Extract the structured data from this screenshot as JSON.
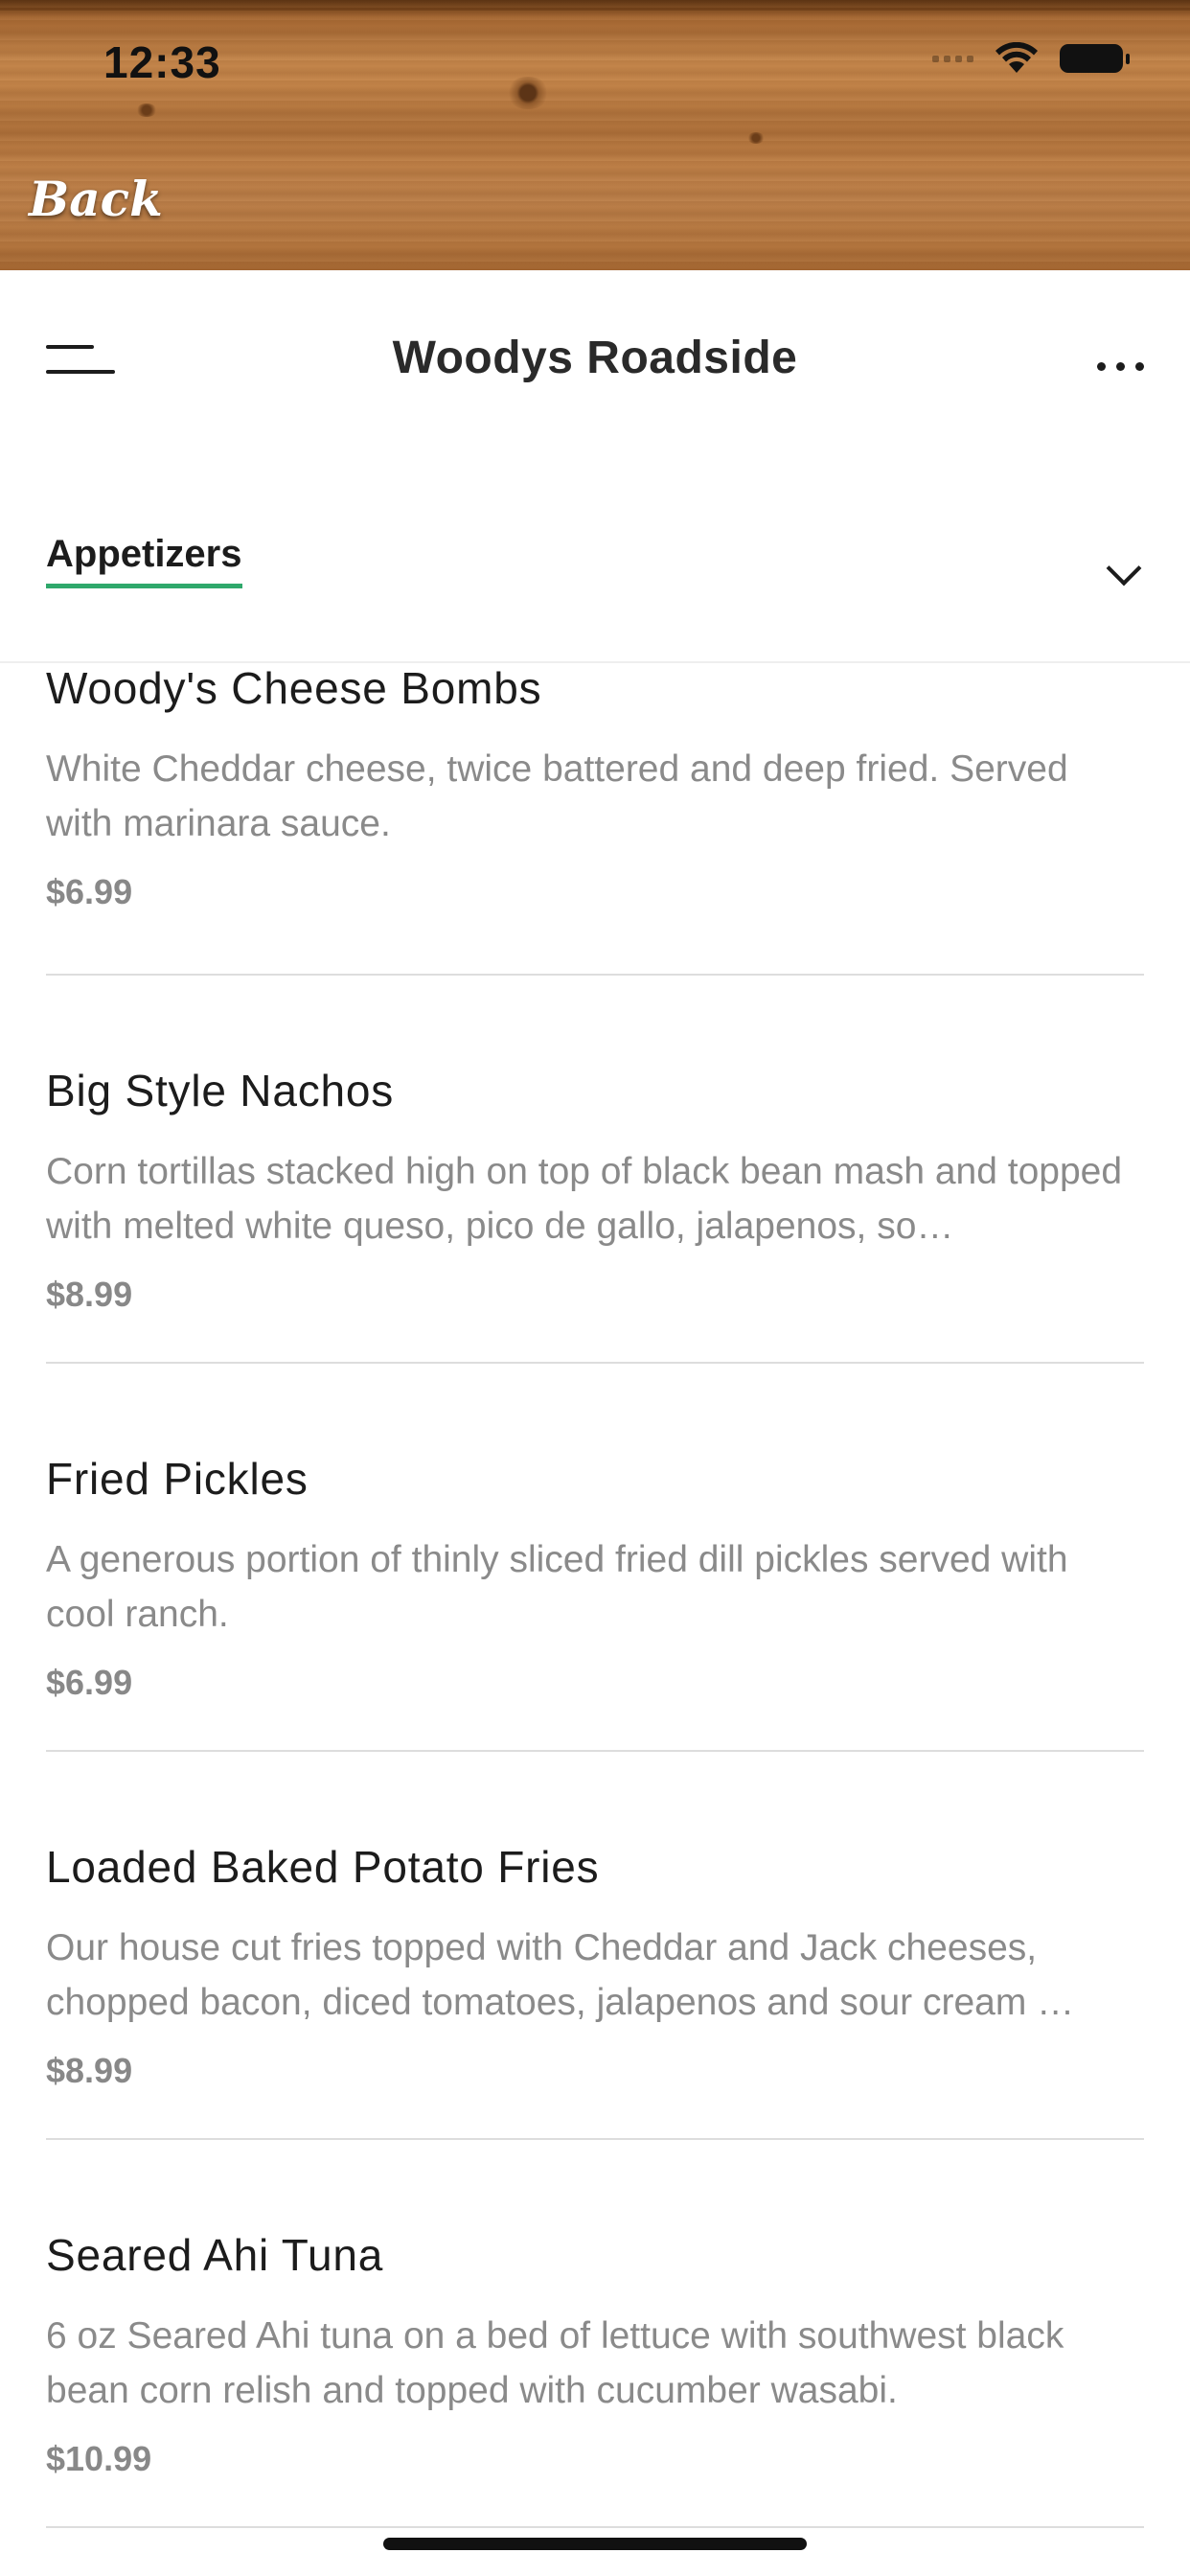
{
  "status_bar": {
    "time": "12:33"
  },
  "header": {
    "back_label": "Back"
  },
  "navbar": {
    "title": "Woodys Roadside"
  },
  "category": {
    "selected": "Appetizers"
  },
  "menu_items": [
    {
      "name": "Woody's Cheese Bombs",
      "description": "White Cheddar cheese, twice battered and deep fried. Served with marinara sauce.",
      "price": "$6.99"
    },
    {
      "name": "Big Style Nachos",
      "description": "Corn tortillas stacked high on top of black bean mash and topped with melted white queso, pico de gallo, jalapenos, so…",
      "price": "$8.99"
    },
    {
      "name": "Fried Pickles",
      "description": "A generous portion of thinly sliced fried dill pickles served with cool ranch.",
      "price": "$6.99"
    },
    {
      "name": "Loaded Baked Potato Fries",
      "description": "Our house cut fries topped with Cheddar and Jack cheeses, chopped bacon, diced tomatoes, jalapenos and sour cream …",
      "price": "$8.99"
    },
    {
      "name": "Seared Ahi Tuna",
      "description": "6 oz Seared Ahi tuna on a bed of lettuce with southwest black bean corn relish and topped with cucumber wasabi.",
      "price": "$10.99"
    }
  ],
  "colors": {
    "accent": "#2fa86b",
    "text": "#1c1c1c",
    "muted": "#8a8a8a"
  },
  "icons": [
    "wifi-icon",
    "battery-icon",
    "hamburger-menu-icon",
    "more-options-icon",
    "chevron-down-icon"
  ]
}
